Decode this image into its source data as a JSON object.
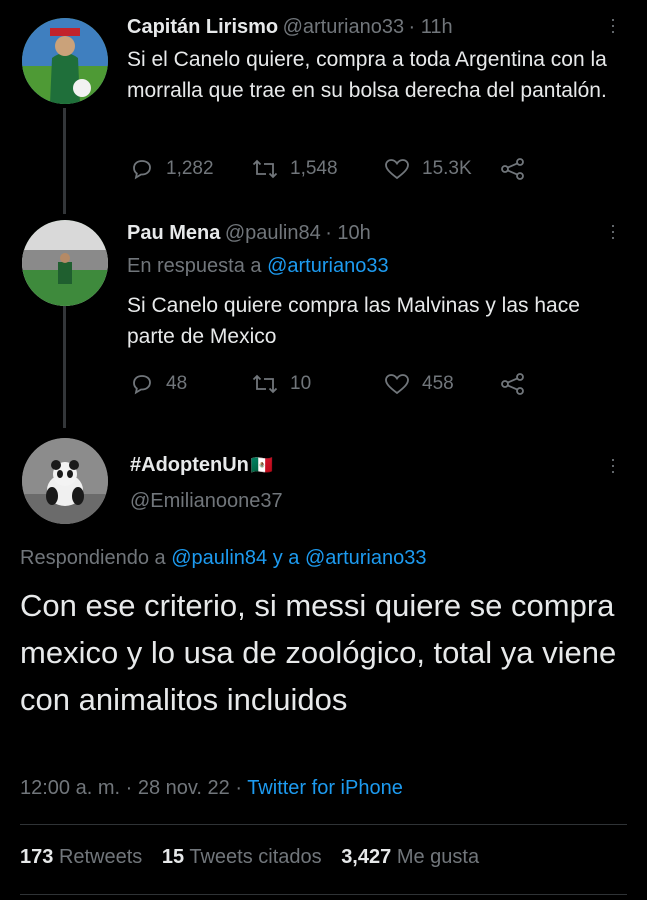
{
  "tweets": [
    {
      "name": "Capitán Lirismo",
      "handle": "@arturiano33",
      "time": "· 11h",
      "text": "Si el Canelo quiere, compra a toda Argentina con la morralla que trae en su bolsa derecha del pantalón.",
      "replies": "1,282",
      "retweets": "1,548",
      "likes": "15.3K"
    },
    {
      "name": "Pau Mena",
      "handle": "@paulin84",
      "time": "· 10h",
      "reply_prefix": "En respuesta a",
      "reply_to": "@arturiano33",
      "text": "Si Canelo quiere compra las Malvinas y las hace parte de Mexico",
      "replies": "48",
      "retweets": "10",
      "likes": "458"
    }
  ],
  "main": {
    "name": "#AdoptenUn",
    "flag": "🇲🇽",
    "handle": "@Emilianoone37",
    "reply_prefix": "Respondiendo a",
    "reply_to_1": "@paulin84",
    "reply_and": "y a",
    "reply_to_2": "@arturiano33",
    "text": "Con ese criterio, si messi quiere se compra mexico y lo usa de zoológico, total ya viene con animalitos incluidos",
    "time": "12:00 a. m. · 28 nov. 22 ·",
    "source": "Twitter for iPhone",
    "stats": {
      "retweets_count": "173",
      "retweets_label": "Retweets",
      "quotes_count": "15",
      "quotes_label": "Tweets citados",
      "likes_count": "3,427",
      "likes_label": "Me gusta"
    }
  },
  "colors": {
    "background": "#000000",
    "text": "#e7e9ea",
    "muted": "#71767b",
    "link": "#1d9bf0"
  }
}
